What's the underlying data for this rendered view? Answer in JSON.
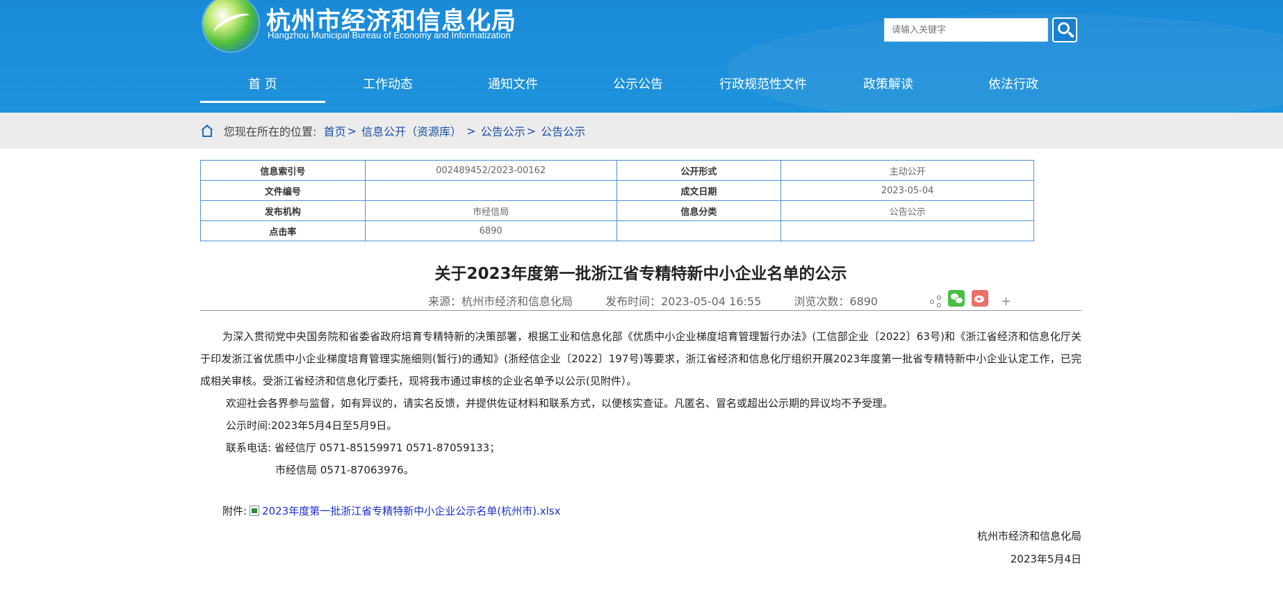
{
  "header": {
    "title": "杭州市经济和信息化局",
    "subtitle": "Hangzhou Municipal Bureau of Economy and Informatization",
    "search_placeholder": "请输入关键字"
  },
  "nav": [
    "首 页",
    "工作动态",
    "通知文件",
    "公示公告",
    "行政规范性文件",
    "政策解读",
    "依法行政"
  ],
  "breadcrumb": {
    "label": "您现在所在的位置:",
    "items": [
      "首页",
      "信息公开（资源库）",
      "公告公示",
      "公告公示"
    ],
    "sep": ">"
  },
  "meta": {
    "rows": [
      {
        "k1": "信息索引号",
        "v1": "002489452/2023-00162",
        "k2": "公开形式",
        "v2": "主动公开"
      },
      {
        "k1": "文件编号",
        "v1": "",
        "k2": "成文日期",
        "v2": "2023-05-04"
      },
      {
        "k1": "发布机构",
        "v1": "市经信局",
        "k2": "信息分类",
        "v2": "公告公示"
      },
      {
        "k1": "点击率",
        "v1": "6890",
        "k2": "",
        "v2": ""
      }
    ]
  },
  "article": {
    "title": "关于2023年度第一批浙江省专精特新中小企业名单的公示",
    "source": "来源：杭州市经济和信息化局",
    "published": "发布时间：2023-05-04 16:55",
    "views": "浏览次数：6890",
    "para1": "为深入贯彻党中央国务院和省委省政府培育专精特新的决策部署，根据工业和信息化部《优质中小企业梯度培育管理暂行办法》(工信部企业〔2022〕63号)和《浙江省经济和信息化厅关于印发浙江省优质中小企业梯度培育管理实施细则(暂行)的通知》(浙经信企业〔2022〕197号)等要求，浙江省经济和信息化厅组织开展2023年度第一批省专精特新中小企业认定工作，已完成相关审核。受浙江省经济和信息化厅委托，现将我市通过审核的企业名单予以公示(见附件）。",
    "para2": "欢迎社会各界参与监督，如有异议的，请实名反馈，并提供佐证材料和联系方式，以便核实查证。凡匿名、冒名或超出公示期的异议均不予受理。",
    "para3": "公示时间:2023年5月4日至5月9日。",
    "para4": "联系电话: 省经信厅 0571-85159971 0571-87059133；",
    "para5": "市经信局 0571-87063976。",
    "attach_label": "附件:",
    "attach_name": "2023年度第一批浙江省专精特新中小企业公示名单(杭州市).xlsx",
    "signer": "杭州市经济和信息化局",
    "sign_date": "2023年5月4日"
  },
  "share": {
    "plus": "+"
  },
  "icons": [
    "logo-icon",
    "search-icon",
    "home-icon",
    "share-icon",
    "wechat-icon",
    "weibo-icon",
    "plus-icon",
    "xlsx-file-icon"
  ]
}
